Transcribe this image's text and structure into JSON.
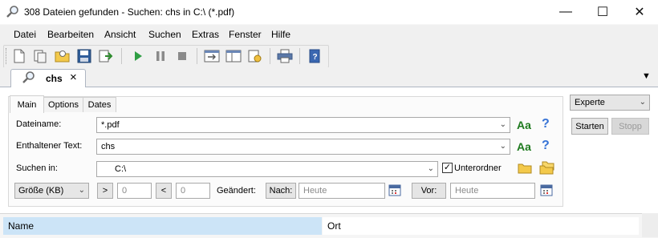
{
  "window": {
    "title": "308 Dateien gefunden - Suchen: chs in C:\\ (*.pdf)",
    "app_icon": "search-magnifier-icon",
    "minimize_glyph": "—",
    "maximize_glyph": "☐",
    "close_glyph": "✕"
  },
  "menu": [
    "Datei",
    "Bearbeiten",
    "Ansicht",
    "Suchen",
    "Extras",
    "Fenster",
    "Hilfe"
  ],
  "toolbar": {
    "icons": [
      "new-document-icon",
      "new-from-template-icon",
      "open-folder-icon",
      "save-icon",
      "export-icon",
      "play-icon",
      "pause-icon",
      "stop-icon",
      "refresh-icon",
      "layout-icon",
      "settings-page-icon",
      "print-icon",
      "book-icon"
    ]
  },
  "tabs": [
    {
      "label": "chs",
      "close": "×"
    }
  ],
  "tab_menu_arrow": "▼",
  "subtabs": [
    "Main",
    "Options",
    "Dates"
  ],
  "form": {
    "filename_label": "Dateiname:",
    "filename_value": "*.pdf",
    "text_label": "Enthaltener Text:",
    "text_value": "chs",
    "case_glyph": "Aa",
    "help_glyph": "?",
    "search_in_label": "Suchen in:",
    "search_in_value": "C:\\",
    "subfolders_label": "Unterordner",
    "subfolders_checked": true,
    "check_glyph": "✓",
    "size_combo": "Größe (KB)",
    "gt": ">",
    "gt_value": "0",
    "lt": "<",
    "lt_value": "0",
    "changed_label": "Geändert:",
    "after_button": "Nach:",
    "after_placeholder": "Heute",
    "before_button": "Vor:",
    "before_placeholder": "Heute"
  },
  "right_panel": {
    "mode": "Experte",
    "start_button": "Starten",
    "stop_button": "Stopp"
  },
  "results": {
    "columns": [
      "Name",
      "Ort"
    ]
  },
  "colors": {
    "accent_header": "#cce4f7",
    "aa_green": "#1e7a1e",
    "help_blue": "#3673d6"
  }
}
